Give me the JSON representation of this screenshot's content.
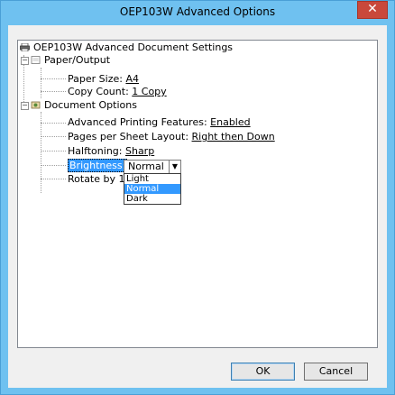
{
  "window": {
    "title": "OEP103W Advanced Options",
    "close_glyph": "✕"
  },
  "tree": {
    "root": "OEP103W Advanced Document Settings",
    "paper_output": {
      "label": "Paper/Output",
      "paper_size_label": "Paper Size:",
      "paper_size_value": "A4",
      "copy_count_label": "Copy Count:",
      "copy_count_value": "1 Copy"
    },
    "document_options": {
      "label": "Document Options",
      "adv_printing_label": "Advanced Printing Features:",
      "adv_printing_value": "Enabled",
      "pps_layout_label": "Pages per Sheet Layout:",
      "pps_layout_value": "Right then Down",
      "halftoning_label": "Halftoning:",
      "halftoning_value": "Sharp",
      "brightness_label": "Brightness:",
      "rotate_label": "Rotate by 18"
    }
  },
  "brightness_combo": {
    "value": "Normal",
    "options": [
      "Light",
      "Normal",
      "Dark"
    ],
    "selected": "Normal"
  },
  "buttons": {
    "ok": "OK",
    "cancel": "Cancel"
  },
  "colors": {
    "titlebar": "#6fc1f0",
    "close": "#c9483b",
    "selection": "#3399ff"
  }
}
